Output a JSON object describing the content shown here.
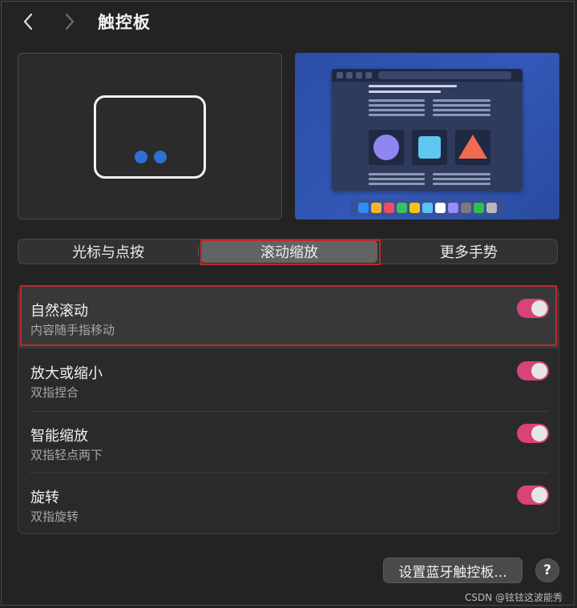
{
  "window": {
    "title": "触控板",
    "back_icon": "chevron-left-icon",
    "forward_icon": "chevron-right-icon"
  },
  "tabs": [
    {
      "label": "光标与点按",
      "selected": false
    },
    {
      "label": "滚动缩放",
      "selected": true
    },
    {
      "label": "更多手势",
      "selected": false
    }
  ],
  "settings": [
    {
      "title": "自然滚动",
      "subtitle": "内容随手指移动",
      "enabled": true
    },
    {
      "title": "放大或缩小",
      "subtitle": "双指捏合",
      "enabled": true
    },
    {
      "title": "智能缩放",
      "subtitle": "双指轻点两下",
      "enabled": true
    },
    {
      "title": "旋转",
      "subtitle": "双指旋转",
      "enabled": true
    }
  ],
  "footer": {
    "bluetooth_button": "设置蓝牙触控板...",
    "help_label": "?"
  },
  "watermark": "CSDN @铉铉这波能秀",
  "colors": {
    "toggle_on": "#d9427a",
    "finger_dot": "#2f6fd1",
    "highlight_border": "#c0282a",
    "preview_bg": "#2f57b5"
  },
  "dock_colors": [
    "#2e8ef3",
    "#f7b42b",
    "#ec4d6a",
    "#37c25d",
    "#f2c514",
    "#5ac6f0",
    "#ffffff",
    "#9a8cf2",
    "#7a7a7a",
    "#2fbf4f",
    "#b8b8b8"
  ]
}
